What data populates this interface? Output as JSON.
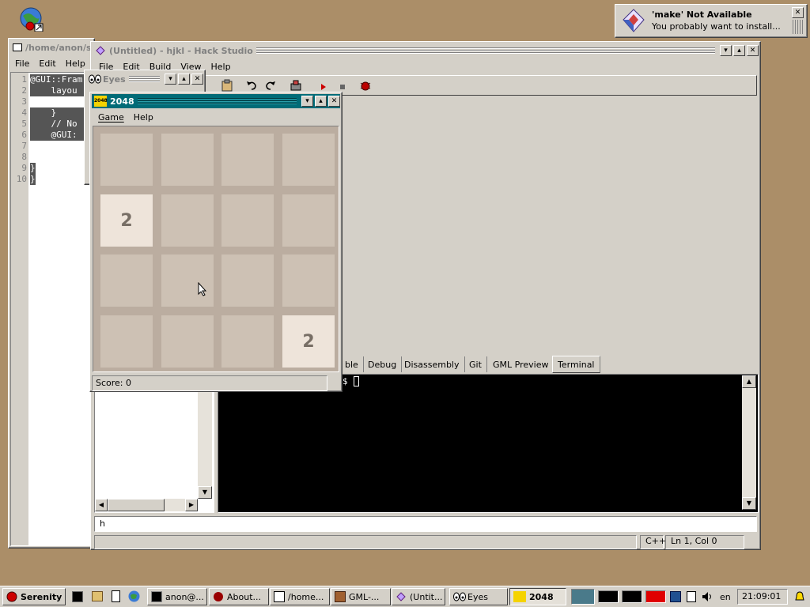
{
  "desktop": {
    "icon": "globe-icon"
  },
  "editor_window": {
    "title": "/home/anon/s",
    "menu": [
      "File",
      "Edit",
      "Help"
    ],
    "lines": [
      {
        "n": "1",
        "text": "@GUI::Fram"
      },
      {
        "n": "2",
        "text": "    layou"
      },
      {
        "n": "3",
        "text": ""
      },
      {
        "n": "4",
        "text": "    }"
      },
      {
        "n": "5",
        "text": "    // No"
      },
      {
        "n": "6",
        "text": "    @GUI:"
      },
      {
        "n": "7",
        "text": ""
      },
      {
        "n": "8",
        "text": ""
      },
      {
        "n": "9",
        "text": "}"
      },
      {
        "n": "10",
        "text": "}"
      }
    ]
  },
  "hack_studio": {
    "title": "(Untitled) - hjkl - Hack Studio",
    "menu": [
      "File",
      "Edit",
      "Build",
      "View",
      "Help"
    ],
    "tabs": [
      "ble",
      "Debug",
      "Disassembly",
      "Git",
      "GML Preview",
      "Terminal"
    ],
    "active_tab": "Terminal",
    "terminal_prompt": "$",
    "input_value": "h",
    "status": {
      "language": "C++",
      "position": "Ln 1, Col 0"
    }
  },
  "eyes_window": {
    "title": "Eyes"
  },
  "game_2048": {
    "title": "2048",
    "icon_label": "2048",
    "menu": [
      "Game",
      "Help"
    ],
    "board": [
      [
        "",
        "",
        "",
        ""
      ],
      [
        "2",
        "",
        "",
        ""
      ],
      [
        "",
        "",
        "",
        ""
      ],
      [
        "",
        "",
        "",
        "2"
      ]
    ],
    "score_label": "Score: 0"
  },
  "notification": {
    "title": "'make' Not Available",
    "message": "You probably want to install..."
  },
  "taskbar": {
    "start": "Serenity",
    "buttons": [
      {
        "label": "anon@...",
        "icon": "terminal-icon"
      },
      {
        "label": "About...",
        "icon": "serenity-icon"
      },
      {
        "label": "/home...",
        "icon": "text-editor-icon"
      },
      {
        "label": "GML-...",
        "icon": "gml-playground-icon"
      },
      {
        "label": "(Untit...",
        "icon": "hack-studio-icon"
      },
      {
        "label": "Eyes",
        "icon": "eyes-icon"
      },
      {
        "label": "2048",
        "icon": "game-2048-icon"
      }
    ],
    "keymap": "en",
    "clock": "21:09:01"
  },
  "colors": {
    "desktop": "#ab8e68",
    "active_title": "#006b77",
    "tile_empty": "#cdc1b4",
    "tile_2": "#eee4da",
    "board": "#bbada0"
  }
}
